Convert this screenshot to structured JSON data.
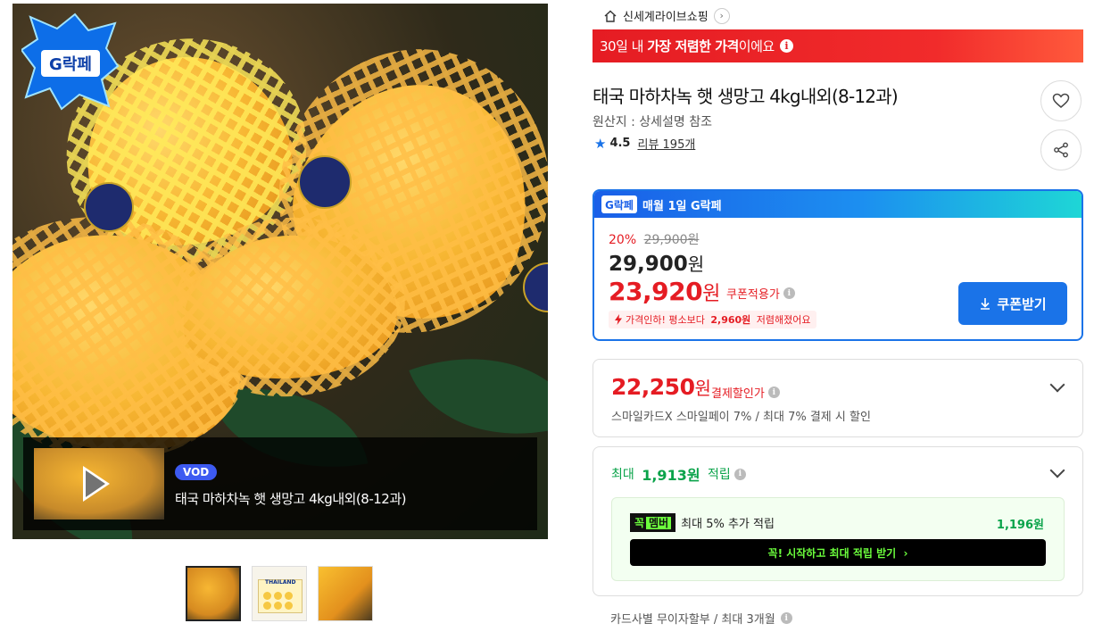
{
  "gallery": {
    "logo_text": "G락페",
    "vod_badge": "VOD",
    "vod_title": "태국 마하차녹 햇 생망고 4kg내외(8-12과)",
    "thumbnails": [
      {
        "name": "thumb-mango-1",
        "active": true
      },
      {
        "name": "thumb-mango-box",
        "active": false
      },
      {
        "name": "thumb-mango-cut",
        "active": false
      }
    ],
    "thumb_box_text": "THAILAND"
  },
  "seller": {
    "name": "신세계라이브쇼핑",
    "arrow": "›"
  },
  "lowest_banner": {
    "prefix": "30일 내 ",
    "highlight": "가장 저렴한 가격",
    "suffix": "이에요",
    "info": "i"
  },
  "product": {
    "title": "태국 마하차녹 햇 생망고 4kg내외(8-12과)",
    "origin": "원산지 : 상세설명 참조",
    "rating": "4.5",
    "review_text": "리뷰 195개"
  },
  "promo": {
    "header_logo": "G락페",
    "header_text": "매월 1일 G락페",
    "discount_rate": "20%",
    "original_price": "29,900원",
    "price_amount": "29,900",
    "price_unit": "원",
    "coupon_price_amount": "23,920",
    "coupon_price_unit": "원",
    "coupon_applied_label": "쿠폰적용가",
    "cheaper_prefix": "가격인하! 평소보다 ",
    "cheaper_amount": "2,960원",
    "cheaper_suffix": " 저렴해졌어요",
    "coupon_button": "쿠폰받기",
    "accent": "#1a73e8",
    "sale_color": "#e51c23"
  },
  "payment": {
    "amount": "22,250",
    "unit": "원",
    "label": "결제할인가",
    "sub": "스마일카드X 스마일페이 7% / 최대 7% 결제 시 할인"
  },
  "points": {
    "prefix": "최대 ",
    "amount": "1,913원",
    "suffix": " 적립",
    "member_badge_a": "꼭",
    "member_badge_b": "멤버",
    "member_text": "최대 5% 추가 적립",
    "member_amount": "1,196원",
    "member_button": "꼭! 시작하고 최대 적립 받기  ›",
    "color": "#0aa34a"
  },
  "installment": {
    "text": "카드사별 무이자할부 / 최대 3개월"
  }
}
